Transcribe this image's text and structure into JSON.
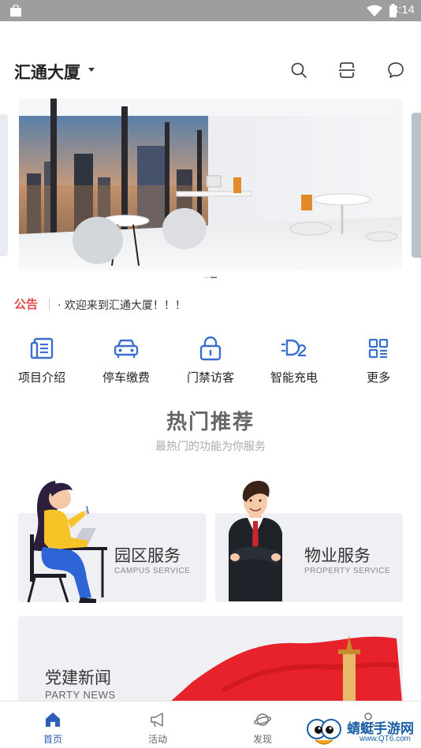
{
  "status_bar": {
    "time": "3:14"
  },
  "header": {
    "title": "汇通大厦",
    "icons": [
      "search-icon",
      "scan-icon",
      "message-icon"
    ]
  },
  "notice": {
    "tag": "公告",
    "text": "· 欢迎来到汇通大厦！！！"
  },
  "quick_menu": [
    {
      "label": "项目介绍",
      "icon": "project-intro-icon"
    },
    {
      "label": "停车缴费",
      "icon": "car-icon"
    },
    {
      "label": "门禁访客",
      "icon": "lock-icon"
    },
    {
      "label": "智能充电",
      "icon": "charging-icon"
    },
    {
      "label": "更多",
      "icon": "grid-icon"
    }
  ],
  "hot": {
    "title": "热门推荐",
    "subtitle": "最热门的功能为你服务"
  },
  "cards": {
    "campus": {
      "title": "园区服务",
      "subtitle": "CAMPUS SERVICE"
    },
    "property": {
      "title": "物业服务",
      "subtitle": "PROPERTY SERVICE"
    },
    "party": {
      "title": "党建新闻",
      "subtitle": "PARTY NEWS"
    }
  },
  "tabs": [
    {
      "label": "首页",
      "icon": "home-icon"
    },
    {
      "label": "活动",
      "icon": "megaphone-icon"
    },
    {
      "label": "发现",
      "icon": "planet-icon"
    },
    {
      "label": "",
      "icon": "user-icon"
    }
  ],
  "watermark": {
    "name": "蜻蜓手游网",
    "url": "www.QT6.com"
  },
  "colors": {
    "accent": "#2d5fb8",
    "notice": "#e54b4b",
    "icon_blue": "#3a6fd1"
  }
}
